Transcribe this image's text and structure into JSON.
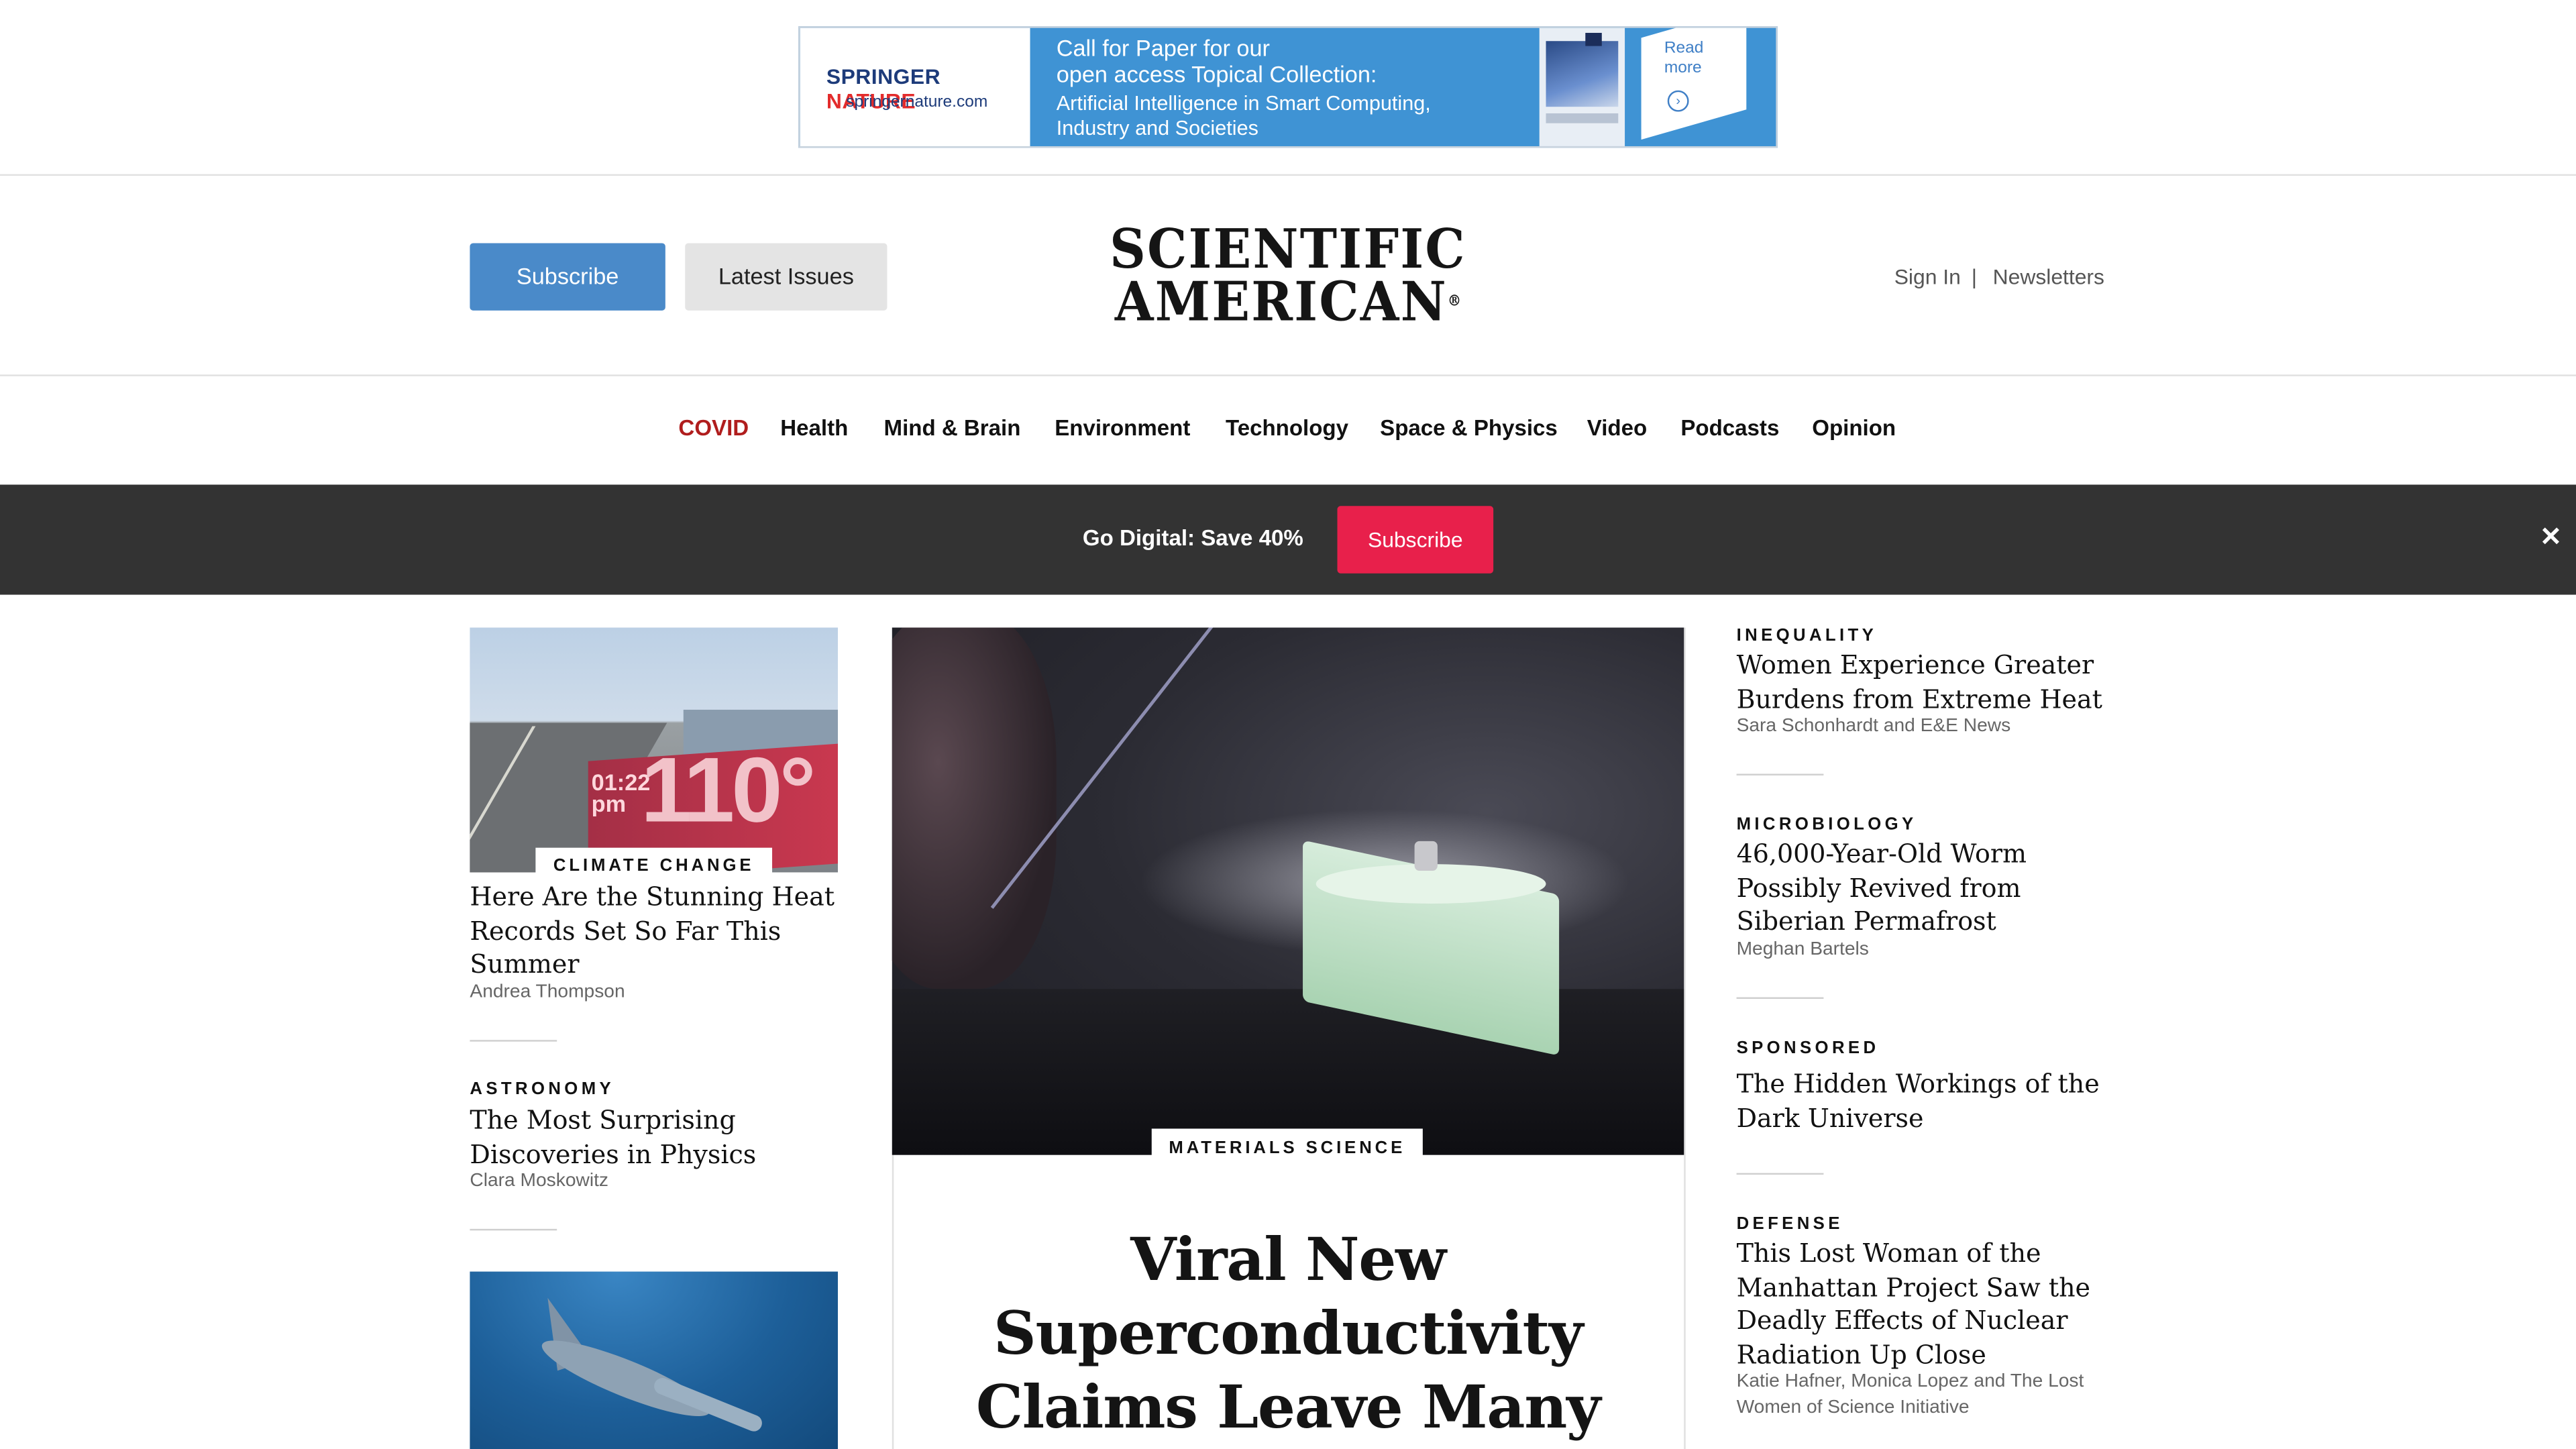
{
  "ad": {
    "brand_part1": "SPRINGER",
    "brand_part2": "NATURE",
    "site": "springernature.com",
    "line1": "Call for Paper for our",
    "line2": "open access Topical Collection:",
    "line3": "Artificial Intelligence in Smart Computing,",
    "line4": "Industry and Societies",
    "read_more_1": "Read",
    "read_more_2": "more"
  },
  "header": {
    "subscribe_label": "Subscribe",
    "latest_issues_label": "Latest Issues",
    "logo_line1": "SCIENTIFIC",
    "logo_line2": "AMERICAN",
    "logo_mark": "®",
    "sign_in": "Sign In",
    "separator": "|",
    "newsletters": "Newsletters"
  },
  "nav": {
    "items": [
      "COVID",
      "Health",
      "Mind & Brain",
      "Environment",
      "Technology",
      "Space & Physics",
      "Video",
      "Podcasts",
      "Opinion"
    ]
  },
  "promo": {
    "text": "Go Digital: Save 40%",
    "button": "Subscribe",
    "close": "✕"
  },
  "left": {
    "image_time": "01:22 pm",
    "image_temp": "110°",
    "articles": [
      {
        "tag": "CLIMATE CHANGE",
        "title": "Here Are the Stunning Heat Records Set So Far This Summer",
        "byline": "Andrea Thompson"
      },
      {
        "tag": "ASTRONOMY",
        "title": "The Most Surprising Discoveries in Physics",
        "byline": "Clara Moskowitz"
      }
    ]
  },
  "feature": {
    "tag": "MATERIALS SCIENCE",
    "title": "Viral New Superconductivity Claims Leave Many"
  },
  "right": {
    "articles": [
      {
        "tag": "INEQUALITY",
        "title": "Women Experience Greater Burdens from Extreme Heat",
        "byline": "Sara Schonhardt and E&E News"
      },
      {
        "tag": "MICROBIOLOGY",
        "title": "46,000-Year-Old Worm Possibly Revived from Siberian Permafrost",
        "byline": "Meghan Bartels"
      },
      {
        "tag": "SPONSORED",
        "title": "The Hidden Workings of the Dark Universe",
        "byline": ""
      },
      {
        "tag": "DEFENSE",
        "title": "This Lost Woman of the Manhattan Project Saw the Deadly Effects of Nuclear Radiation Up Close",
        "byline": "Katie Hafner, Monica Lopez and The Lost Women of Science Initiative"
      }
    ]
  },
  "colors": {
    "subscribe_blue": "#4a8ac9",
    "promo_bar": "#333333",
    "promo_button": "#e8204b",
    "covid_red": "#b01d1d"
  }
}
